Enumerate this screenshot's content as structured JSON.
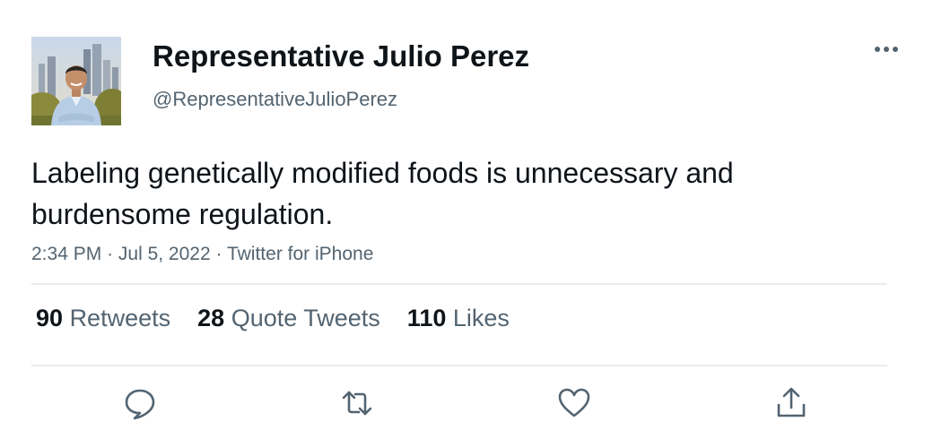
{
  "profile": {
    "display_name": "Representative Julio Perez",
    "handle": "@RepresentativeJulioPerez",
    "avatar_icon": "profile-photo"
  },
  "tweet": {
    "text": "Labeling genetically modified foods is unnecessary and burdensome regulation.",
    "time": "2:34 PM",
    "date": "Jul 5, 2022",
    "source": "Twitter for iPhone",
    "separator": "·"
  },
  "stats": {
    "retweets": {
      "count": "90",
      "label": "Retweets"
    },
    "quotes": {
      "count": "28",
      "label": "Quote Tweets"
    },
    "likes": {
      "count": "110",
      "label": "Likes"
    }
  },
  "actions": [
    "reply-icon",
    "retweet-icon",
    "like-icon",
    "share-icon"
  ],
  "colors": {
    "text_primary": "#0f1419",
    "text_secondary": "#536471",
    "divider": "#e6ecf0"
  }
}
